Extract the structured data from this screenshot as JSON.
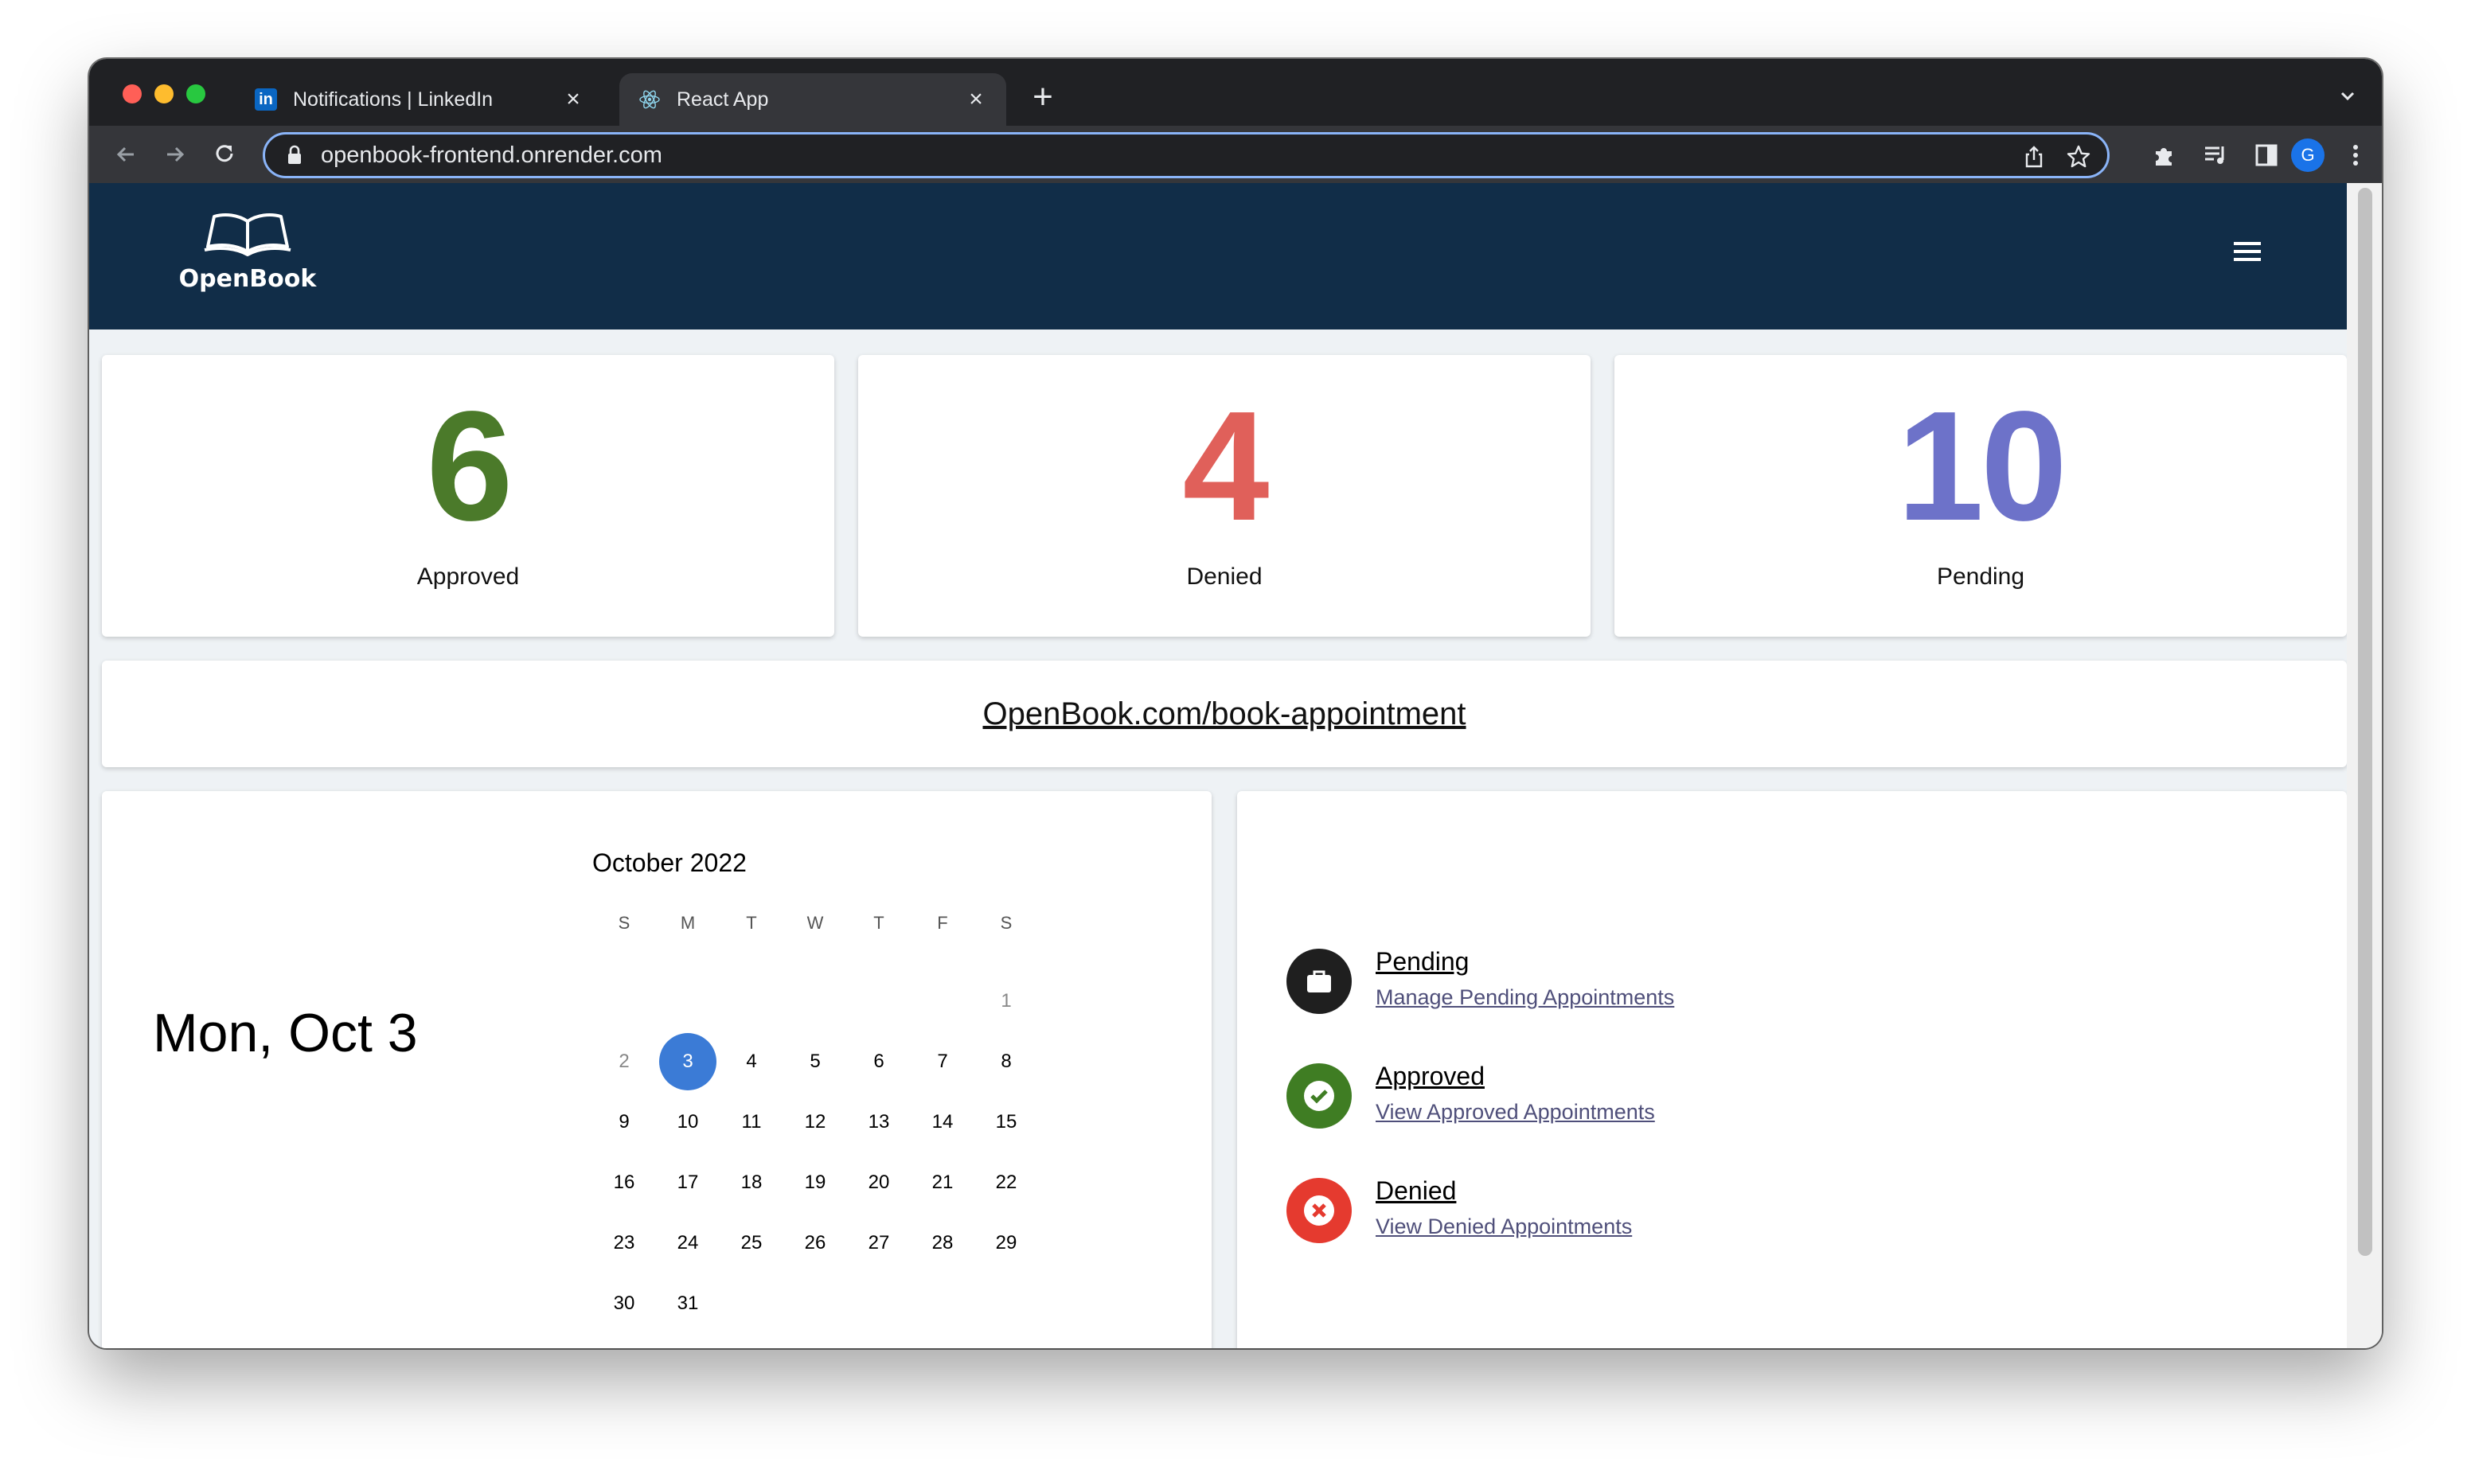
{
  "browser": {
    "tabs": [
      {
        "title": "Notifications | LinkedIn",
        "favicon": "linkedin-icon",
        "active": false
      },
      {
        "title": "React App",
        "favicon": "react-icon",
        "active": true
      }
    ],
    "url": "openbook-frontend.onrender.com",
    "profile_initial": "G"
  },
  "app": {
    "name": "OpenBook",
    "stats": [
      {
        "value": "6",
        "label": "Approved",
        "color": "#4b7a2a"
      },
      {
        "value": "4",
        "label": "Denied",
        "color": "#e0605a"
      },
      {
        "value": "10",
        "label": "Pending",
        "color": "#6d72c9"
      }
    ],
    "booking_link": "OpenBook.com/book-appointment",
    "today": "Mon, Oct 3",
    "calendar": {
      "title": "October 2022",
      "weekdays": [
        "S",
        "M",
        "T",
        "W",
        "T",
        "F",
        "S"
      ],
      "weeks": [
        [
          "",
          "",
          "",
          "",
          "",
          "",
          "1"
        ],
        [
          "2",
          "3",
          "4",
          "5",
          "6",
          "7",
          "8"
        ],
        [
          "9",
          "10",
          "11",
          "12",
          "13",
          "14",
          "15"
        ],
        [
          "16",
          "17",
          "18",
          "19",
          "20",
          "21",
          "22"
        ],
        [
          "23",
          "24",
          "25",
          "26",
          "27",
          "28",
          "29"
        ],
        [
          "30",
          "31",
          "",
          "",
          "",
          "",
          ""
        ]
      ],
      "selected": "3"
    },
    "status_links": [
      {
        "title": "Pending",
        "subtitle": "Manage Pending Appointments",
        "icon": "briefcase-icon",
        "color": "#1f1f1f"
      },
      {
        "title": "Approved",
        "subtitle": "View Approved Appointments",
        "icon": "check-icon",
        "color": "#3f7d23"
      },
      {
        "title": "Denied",
        "subtitle": "View Denied Appointments",
        "icon": "x-icon",
        "color": "#e53a2f"
      }
    ]
  }
}
